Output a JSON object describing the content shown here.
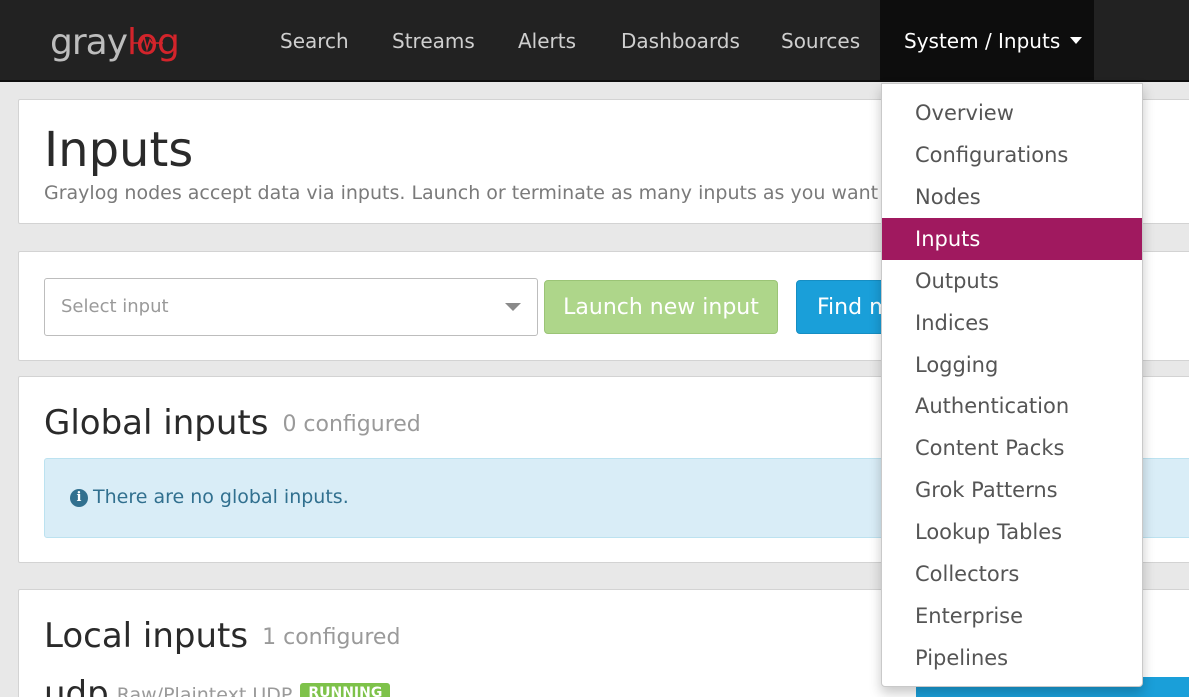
{
  "navbar": {
    "logo": {
      "part1": "gray",
      "part2": "log"
    },
    "items": [
      "Search",
      "Streams",
      "Alerts",
      "Dashboards",
      "Sources"
    ],
    "active": "System / Inputs"
  },
  "dropdown": {
    "items": [
      "Overview",
      "Configurations",
      "Nodes",
      "Inputs",
      "Outputs",
      "Indices",
      "Logging",
      "Authentication",
      "Content Packs",
      "Grok Patterns",
      "Lookup Tables",
      "Collectors",
      "Enterprise",
      "Pipelines"
    ],
    "selected": "Inputs"
  },
  "header": {
    "title": "Inputs",
    "description": "Graylog nodes accept data via inputs. Launch or terminate as many inputs as you want here"
  },
  "launch": {
    "select_placeholder": "Select input",
    "launch_button": "Launch new input",
    "find_button": "Find m"
  },
  "global_inputs": {
    "title": "Global inputs",
    "count": "0 configured",
    "empty_message": "There are no global inputs."
  },
  "local_inputs": {
    "title": "Local inputs",
    "count": "1 configured",
    "input": {
      "name": "udp",
      "type": "Raw/Plaintext UDP",
      "status": "RUNNING"
    }
  },
  "colors": {
    "navbar_bg": "#222222",
    "brand_red": "#d3242b",
    "active_menu": "#a0195f",
    "launch_button": "#aed68a",
    "find_button": "#1a9fd9",
    "info_bg": "#d9edf7",
    "running_badge": "#7ec24a"
  },
  "icons": {
    "select_arrow": "chevron-down-icon",
    "info": "info-circle-icon",
    "caret": "caret-down-icon"
  }
}
